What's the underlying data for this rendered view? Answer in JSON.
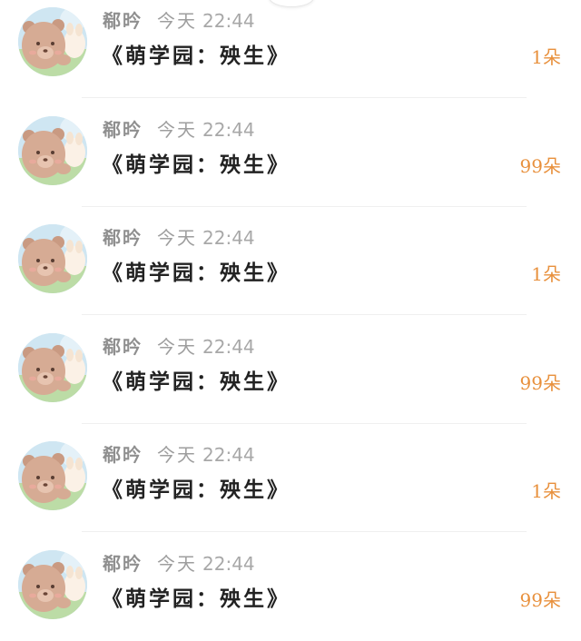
{
  "messages": [
    {
      "name": "郗昑",
      "date": "今天",
      "time": "22:44",
      "title": "《萌学园：殃生》",
      "count": "1朵"
    },
    {
      "name": "郗昑",
      "date": "今天",
      "time": "22:44",
      "title": "《萌学园：殃生》",
      "count": "99朵"
    },
    {
      "name": "郗昑",
      "date": "今天",
      "time": "22:44",
      "title": "《萌学园：殃生》",
      "count": "1朵"
    },
    {
      "name": "郗昑",
      "date": "今天",
      "time": "22:44",
      "title": "《萌学园：殃生》",
      "count": "99朵"
    },
    {
      "name": "郗昑",
      "date": "今天",
      "time": "22:44",
      "title": "《萌学园：殃生》",
      "count": "1朵"
    },
    {
      "name": "郗昑",
      "date": "今天",
      "time": "22:44",
      "title": "《萌学园：殃生》",
      "count": "99朵"
    }
  ],
  "colors": {
    "count": "#e8903c",
    "title": "#222222",
    "meta": "#9e9e9e"
  },
  "avatar_icon": "bear-avatar-icon"
}
